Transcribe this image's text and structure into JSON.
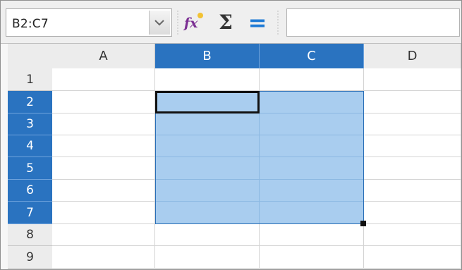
{
  "formula_bar": {
    "name_box_value": "B2:C7",
    "formula_value": "",
    "icons": {
      "dropdown": "chevron-down-icon",
      "function_wizard": "function-wizard-icon",
      "sum": "sigma-icon",
      "formula": "equals-icon"
    },
    "function_wizard_glyph": "fx",
    "sum_glyph": "Σ",
    "formula_glyph": "="
  },
  "sheet": {
    "columns": [
      "A",
      "B",
      "C",
      "D"
    ],
    "rows": [
      "1",
      "2",
      "3",
      "4",
      "5",
      "6",
      "7",
      "8",
      "9"
    ],
    "selection": "B2:C7",
    "active_cell": "B2"
  },
  "colors": {
    "selection_header": "#2a73c0",
    "selection_fill": "#a9cdef",
    "header_bg": "#ececec"
  }
}
